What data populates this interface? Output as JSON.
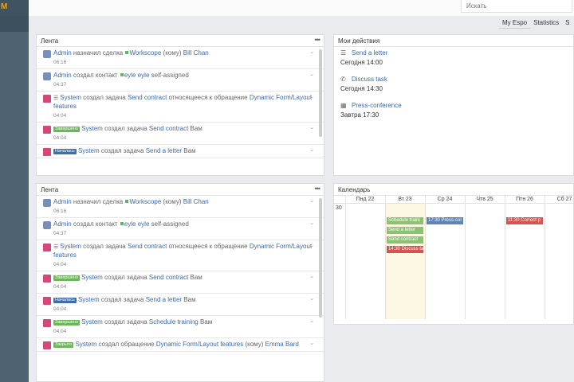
{
  "app": {
    "logo_text": "M"
  },
  "search": {
    "placeholder": "Искать"
  },
  "tabs": [
    {
      "label": "My Espo",
      "active": true
    },
    {
      "label": "Statistics",
      "active": false
    },
    {
      "label": "S",
      "active": false
    }
  ],
  "feed_panels": [
    {
      "title": "Лента",
      "items": [
        {
          "icon": "user",
          "parts": [
            [
              "lnk",
              "Admin"
            ],
            [
              "grey",
              " назначил сделка "
            ],
            [
              "dot",
              ""
            ],
            [
              "lnk",
              "Workscope"
            ],
            [
              "grey",
              " (кому) "
            ],
            [
              "lnk",
              "Bill Chan"
            ]
          ],
          "time": "06:16"
        },
        {
          "icon": "user",
          "parts": [
            [
              "lnk",
              "Admin"
            ],
            [
              "grey",
              " создал контакт "
            ],
            [
              "dot",
              ""
            ],
            [
              "lnk",
              "eyle eyle"
            ],
            [
              "grey",
              " self-assigned"
            ]
          ],
          "time": "04:37"
        },
        {
          "icon": "task",
          "parts": [
            [
              "listic",
              "☰ "
            ],
            [
              "lnk",
              "System"
            ],
            [
              "grey",
              " создал задача "
            ],
            [
              "lnk",
              "Send contract"
            ],
            [
              "grey",
              " относящееся к обращение "
            ],
            [
              "lnk",
              "Dynamic Form/Layout features"
            ]
          ],
          "time": "04:04"
        },
        {
          "icon": "task",
          "parts": [
            [
              "b-done",
              "Завершено"
            ],
            [
              "grey",
              " "
            ],
            [
              "lnk",
              "System"
            ],
            [
              "grey",
              " создал задача "
            ],
            [
              "lnk",
              "Send contract"
            ],
            [
              "grey",
              " Вам"
            ]
          ],
          "time": "04:04"
        },
        {
          "icon": "task",
          "parts": [
            [
              "b-start",
              "Началась"
            ],
            [
              "grey",
              " "
            ],
            [
              "lnk",
              "System"
            ],
            [
              "grey",
              " создал задача "
            ],
            [
              "lnk",
              "Send a letter"
            ],
            [
              "grey",
              " Вам"
            ]
          ],
          "time": ""
        }
      ]
    },
    {
      "title": "Лента",
      "items": [
        {
          "icon": "user",
          "parts": [
            [
              "lnk",
              "Admin"
            ],
            [
              "grey",
              " назначил сделка "
            ],
            [
              "dot",
              ""
            ],
            [
              "lnk",
              "Workscope"
            ],
            [
              "grey",
              " (кому) "
            ],
            [
              "lnk",
              "Bill Chan"
            ]
          ],
          "time": "06:16"
        },
        {
          "icon": "user",
          "parts": [
            [
              "lnk",
              "Admin"
            ],
            [
              "grey",
              " создал контакт "
            ],
            [
              "dot",
              ""
            ],
            [
              "lnk",
              "eyle eyle"
            ],
            [
              "grey",
              " self-assigned"
            ]
          ],
          "time": "04:37"
        },
        {
          "icon": "task",
          "parts": [
            [
              "listic",
              "☰ "
            ],
            [
              "lnk",
              "System"
            ],
            [
              "grey",
              " создал задача "
            ],
            [
              "lnk",
              "Send contract"
            ],
            [
              "grey",
              " относящееся к обращение "
            ],
            [
              "lnk",
              "Dynamic Form/Layout features"
            ]
          ],
          "time": "04:04"
        },
        {
          "icon": "task",
          "parts": [
            [
              "b-done",
              "Завершено"
            ],
            [
              "grey",
              " "
            ],
            [
              "lnk",
              "System"
            ],
            [
              "grey",
              " создал задача "
            ],
            [
              "lnk",
              "Send contract"
            ],
            [
              "grey",
              " Вам"
            ]
          ],
          "time": "04:04"
        },
        {
          "icon": "task",
          "parts": [
            [
              "b-start",
              "Началась"
            ],
            [
              "grey",
              " "
            ],
            [
              "lnk",
              "System"
            ],
            [
              "grey",
              " создал задача "
            ],
            [
              "lnk",
              "Send a letter"
            ],
            [
              "grey",
              " Вам"
            ]
          ],
          "time": "04:04"
        },
        {
          "icon": "task",
          "parts": [
            [
              "b-done",
              "Завершено"
            ],
            [
              "grey",
              " "
            ],
            [
              "lnk",
              "System"
            ],
            [
              "grey",
              " создал задача "
            ],
            [
              "lnk",
              "Schedule training"
            ],
            [
              "grey",
              " Вам"
            ]
          ],
          "time": "04:04"
        },
        {
          "icon": "task",
          "parts": [
            [
              "b-closed",
              "Закрыто"
            ],
            [
              "grey",
              " "
            ],
            [
              "lnk",
              "System"
            ],
            [
              "grey",
              " создал обращение "
            ],
            [
              "lnk",
              "Dynamic Form/Layout features"
            ],
            [
              "grey",
              " (кому) "
            ],
            [
              "lnk",
              "Emma Bard"
            ]
          ],
          "time": ""
        }
      ]
    }
  ],
  "actions": {
    "title": "Мои действия",
    "items": [
      {
        "icon": "list-icon",
        "glyph": "☰",
        "title": "Send a letter",
        "when": "Сегодня 14:00"
      },
      {
        "icon": "phone-icon",
        "glyph": "✆",
        "title": "Discuss task",
        "when": "Сегодня 14:30"
      },
      {
        "icon": "calendar-icon",
        "glyph": "▦",
        "title": "Press-conference",
        "when": "Завтра 17:30"
      }
    ]
  },
  "calendar": {
    "title": "Календарь",
    "week_number": "30",
    "days": [
      "Пнд 22",
      "Вт 23",
      "Ср 24",
      "Чтв 25",
      "Птн 26",
      "Сб 27"
    ],
    "today_index": 1,
    "events": [
      {
        "day": 1,
        "row": 0,
        "label": "Schedule traini",
        "color": "green"
      },
      {
        "day": 1,
        "row": 1,
        "label": "Send a letter",
        "color": "green"
      },
      {
        "day": 1,
        "row": 2,
        "label": "Send contract",
        "color": "green"
      },
      {
        "day": 1,
        "row": 3,
        "label": "14:30 Discuss ta",
        "color": "red"
      },
      {
        "day": 2,
        "row": 0,
        "label": "17:30 Press-cor",
        "color": "blue"
      },
      {
        "day": 4,
        "row": 0,
        "label": "11:30 Correct p",
        "color": "red"
      }
    ]
  },
  "colors": {
    "accent": "#3e6aa8",
    "sidebar": "#4e6271",
    "task_icon": "#d5477b"
  }
}
